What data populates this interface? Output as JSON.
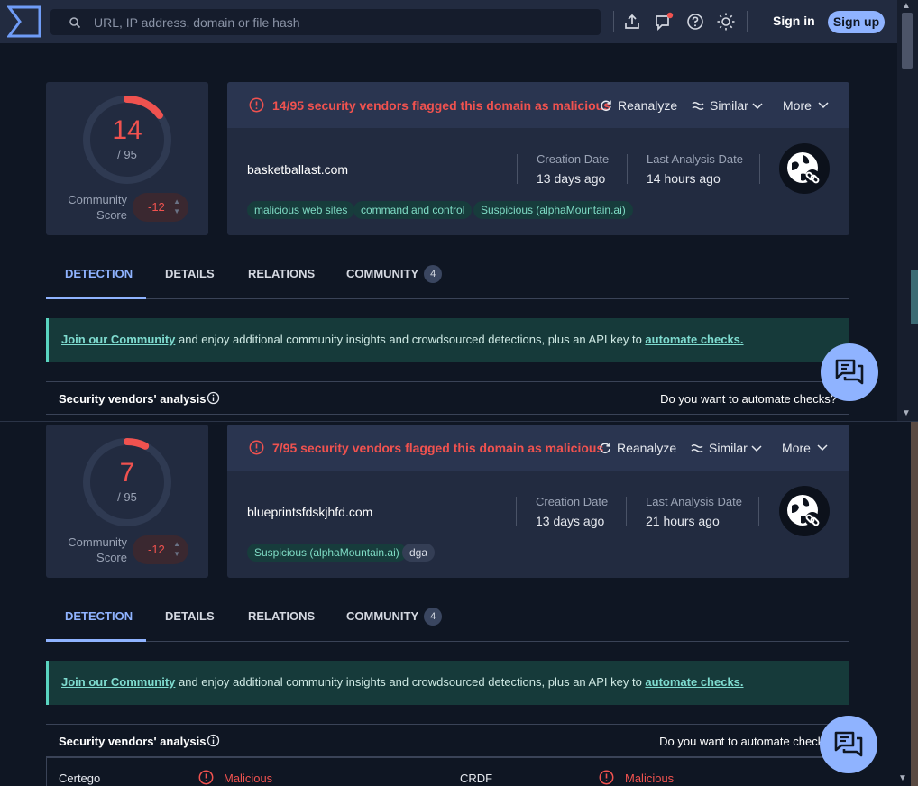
{
  "header": {
    "search_placeholder": "URL, IP address, domain or file hash",
    "sign_in": "Sign in",
    "sign_up": "Sign up"
  },
  "panes": [
    {
      "score": "14",
      "score_fraction": 0.147,
      "total": "/ 95",
      "community_label_1": "Community",
      "community_label_2": "Score",
      "community_score": "-12",
      "flag_text": "14/95 security vendors flagged this domain as malicious",
      "reanalyze": "Reanalyze",
      "similar": "Similar",
      "more": "More",
      "domain": "basketballast.com",
      "creation_label": "Creation Date",
      "creation_value": "13 days ago",
      "last_label": "Last Analysis Date",
      "last_value": "14 hours ago",
      "tags": [
        {
          "text": "malicious web sites",
          "style": "green"
        },
        {
          "text": "command and control",
          "style": "green"
        },
        {
          "text": "Suspicious (alphaMountain.ai)",
          "style": "green"
        }
      ],
      "tabs": {
        "detection": "DETECTION",
        "details": "DETAILS",
        "relations": "RELATIONS",
        "community": "COMMUNITY",
        "community_count": "4"
      },
      "banner": {
        "link1": "Join our Community",
        "middle": " and enjoy additional community insights and crowdsourced detections, plus an API key to ",
        "link2": "automate checks."
      },
      "vendors_title": "Security vendors' analysis",
      "automate_q": "Do you want to automate checks?"
    },
    {
      "score": "7",
      "score_fraction": 0.074,
      "total": "/ 95",
      "community_label_1": "Community",
      "community_label_2": "Score",
      "community_score": "-12",
      "flag_text": "7/95 security vendors flagged this domain as malicious",
      "reanalyze": "Reanalyze",
      "similar": "Similar",
      "more": "More",
      "domain": "blueprintsfdskjhfd.com",
      "creation_label": "Creation Date",
      "creation_value": "13 days ago",
      "last_label": "Last Analysis Date",
      "last_value": "21 hours ago",
      "tags": [
        {
          "text": "Suspicious (alphaMountain.ai)",
          "style": "green"
        },
        {
          "text": "dga",
          "style": "gray"
        }
      ],
      "tabs": {
        "detection": "DETECTION",
        "details": "DETAILS",
        "relations": "RELATIONS",
        "community": "COMMUNITY",
        "community_count": "4"
      },
      "banner": {
        "link1": "Join our Community",
        "middle": " and enjoy additional community insights and crowdsourced detections, plus an API key to ",
        "link2": "automate checks."
      },
      "vendors_title": "Security vendors' analysis",
      "automate_q": "Do you want to automate checks?",
      "vendor_rows": [
        {
          "name": "Certego",
          "result": "Malicious",
          "name2": "CRDF",
          "result2": "Malicious"
        }
      ]
    }
  ],
  "colors": {
    "accent": "#8fb3ff",
    "malicious": "#f0524f",
    "tag_green": "#7fdcc5",
    "background": "#0f1623",
    "card": "#222b40"
  }
}
